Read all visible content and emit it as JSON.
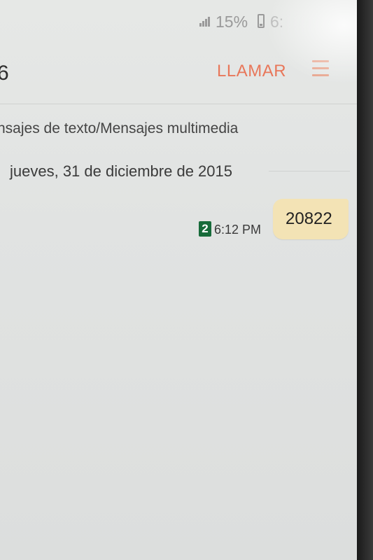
{
  "status_bar": {
    "battery_percent": "15%",
    "clock": "6:"
  },
  "header": {
    "contact": "6",
    "call_label": "LLAMAR"
  },
  "conversation": {
    "message_type_label": "nsajes de texto/Mensajes multimedia",
    "date_separator": "jueves, 31 de diciembre de 2015",
    "messages": [
      {
        "text": "20822",
        "time": "6:12 PM",
        "sim_slot": "2",
        "direction": "outgoing"
      }
    ]
  },
  "colors": {
    "accent": "#e8775a",
    "bubble_out": "#f3e3b5",
    "sim_badge": "#176b3a"
  },
  "icons": [
    "signal-icon",
    "battery-icon",
    "menu-icon",
    "sim-icon"
  ]
}
